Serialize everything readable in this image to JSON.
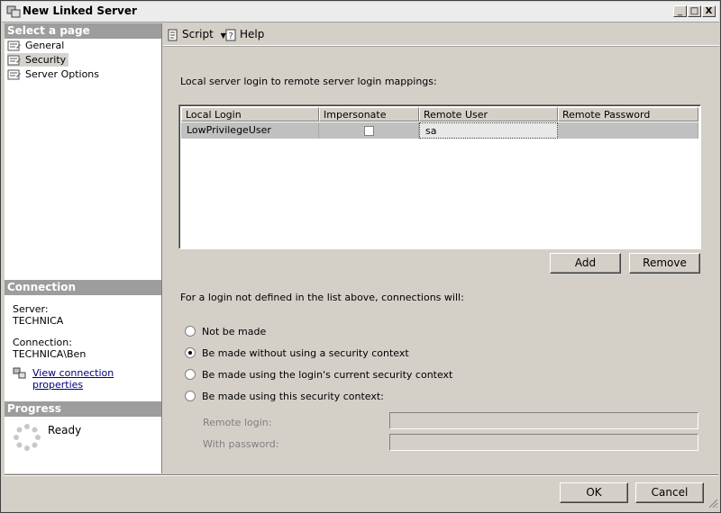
{
  "window": {
    "title": "New Linked Server",
    "controls": {
      "minimize": "_",
      "maximize": "□",
      "close": "X"
    }
  },
  "left": {
    "select_page_header": "Select a page",
    "pages": [
      "General",
      "Security",
      "Server Options"
    ],
    "selected_page": "Security",
    "connection_header": "Connection",
    "server_label": "Server:",
    "server_value": "TECHNICA",
    "connection_label": "Connection:",
    "connection_value": "TECHNICA\\Ben",
    "view_connection_link": "View connection properties",
    "progress_header": "Progress",
    "progress_status": "Ready"
  },
  "toolbar": {
    "script_label": "Script",
    "help_label": "Help",
    "icons": [
      "script-icon",
      "dropdown-arrow-icon",
      "help-icon"
    ]
  },
  "security": {
    "mappings_label": "Local server login to remote server login mappings:",
    "columns": [
      "Local Login",
      "Impersonate",
      "Remote User",
      "Remote Password"
    ],
    "rows": [
      {
        "local_login": "LowPrivilegeUser",
        "impersonate": false,
        "remote_user": "sa",
        "remote_password": ""
      }
    ],
    "add_button": "Add",
    "remove_button": "Remove",
    "undefined_login_label": "For a login not defined in the list above, connections will:",
    "options": [
      "Not be made",
      "Be made without using a security context",
      "Be made using the login's current security context",
      "Be made using this security context:"
    ],
    "selected_option": 1,
    "remote_login_label": "Remote login:",
    "remote_login_value": "",
    "with_password_label": "With password:",
    "with_password_value": ""
  },
  "footer": {
    "ok_button": "OK",
    "cancel_button": "Cancel"
  }
}
